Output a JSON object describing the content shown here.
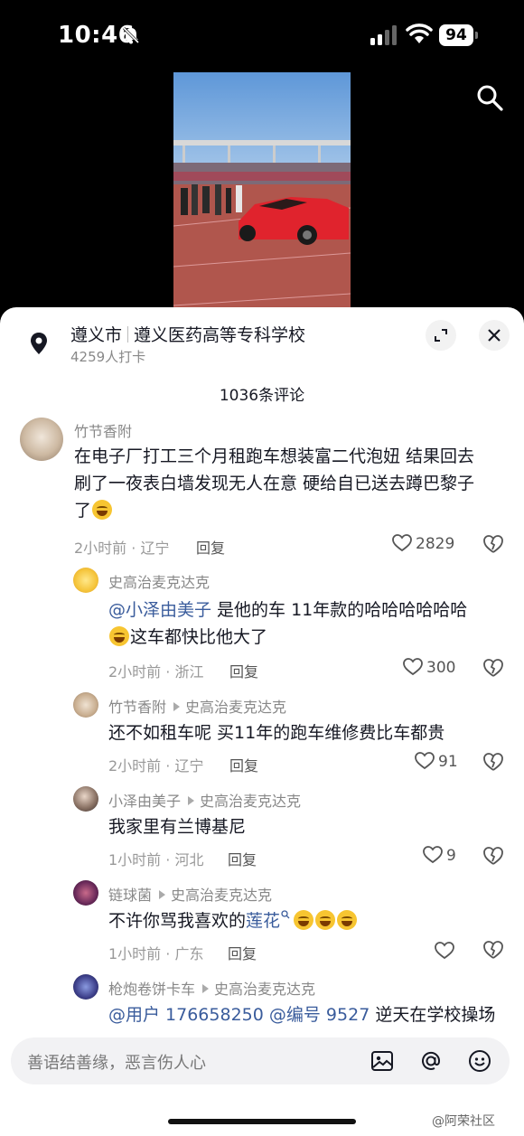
{
  "status_bar": {
    "time": "10:46",
    "battery": "94"
  },
  "location": {
    "city": "遵义市",
    "place": "遵义医药高等专科学校",
    "checkins": "4259人打卡"
  },
  "comment_count": "1036条评论",
  "comments": [
    {
      "user": "竹节香附",
      "lines": [
        "在电子厂打工三个月租跑车想装富二代泡妞 结果回去",
        "刷了一夜表白墙发现无人在意 硬给自已送去蹲巴黎子",
        "了"
      ],
      "meta": "2小时前 · 辽宁",
      "reply": "回复",
      "likes": "2829"
    },
    {
      "user": "史高治麦克达克",
      "mention": "@小泽由美子",
      "line1_rest": " 是他的车 11年款的哈哈哈哈哈哈",
      "line2": "这车都快比他大了",
      "meta": "2小时前 · 浙江",
      "reply": "回复",
      "likes": "300"
    },
    {
      "user": "竹节香附",
      "reply_to": "史高治麦克达克",
      "text": "还不如租车呢 买11年的跑车维修费比车都贵",
      "meta": "2小时前 · 辽宁",
      "reply": "回复",
      "likes": "91"
    },
    {
      "user": "小泽由美子",
      "reply_to": "史高治麦克达克",
      "text": "我家里有兰博基尼",
      "meta": "1小时前 · 河北",
      "reply": "回复",
      "likes": "9"
    },
    {
      "user": "链球菌",
      "reply_to": "史高治麦克达克",
      "text": "不许你骂我喜欢的",
      "link": "莲花",
      "meta": "1小时前 · 广东",
      "reply": "回复"
    },
    {
      "user": "枪炮卷饼卡车",
      "reply_to": "史高治麦克达克",
      "mention1": "@用户 176658250",
      "mention2": "@编号 9527",
      "text_rest": " 逆天在学校操场"
    }
  ],
  "input": {
    "placeholder": "善语结善缘，恶言伤人心"
  },
  "watermark": "@阿荣社区",
  "colors": {
    "accent_link": "#3a5c9c",
    "sheet_bg": "#ffffff",
    "text_primary": "#161823",
    "text_secondary": "#888888"
  }
}
